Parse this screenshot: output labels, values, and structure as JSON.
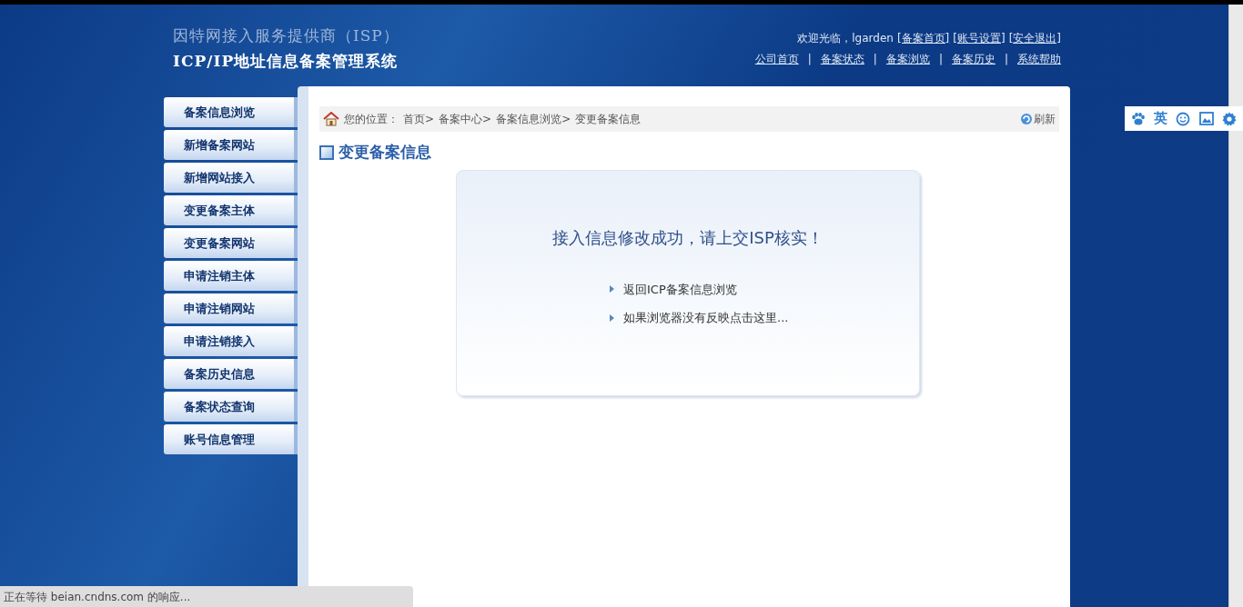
{
  "header": {
    "title_line_1": "因特网接入服务提供商（ISP）",
    "title_line_2": "ICP/IP地址信息备案管理系统",
    "welcome": "欢迎光临，lgarden",
    "user_links": [
      "[备案首页]",
      "[账号设置]",
      "[安全退出]"
    ],
    "nav_links": [
      "公司首页",
      "备案状态",
      "备案浏览",
      "备案历史",
      "系统帮助"
    ],
    "nav_separator": "|"
  },
  "sidebar": {
    "items": [
      "备案信息浏览",
      "新增备案网站",
      "新增网站接入",
      "变更备案主体",
      "变更备案网站",
      "申请注销主体",
      "申请注销网站",
      "申请注销接入",
      "备案历史信息",
      "备案状态查询",
      "账号信息管理"
    ]
  },
  "breadcrumb": {
    "label": "您的位置：",
    "items": [
      "首页>",
      "备案中心>",
      "备案信息浏览>",
      "变更备案信息"
    ],
    "refresh": "刷新"
  },
  "page_title": "变更备案信息",
  "message": {
    "text": "接入信息修改成功，请上交ISP核实！",
    "links": [
      "返回ICP备案信息浏览",
      "如果浏览器没有反映点击这里..."
    ]
  },
  "floating_toolbar": {
    "items": [
      {
        "kind": "paw"
      },
      {
        "kind": "text",
        "label": "英"
      },
      {
        "kind": "smile"
      },
      {
        "kind": "image"
      },
      {
        "kind": "gear"
      }
    ]
  },
  "status_bar": {
    "text": "正在等待 beian.cndns.com 的响应..."
  }
}
